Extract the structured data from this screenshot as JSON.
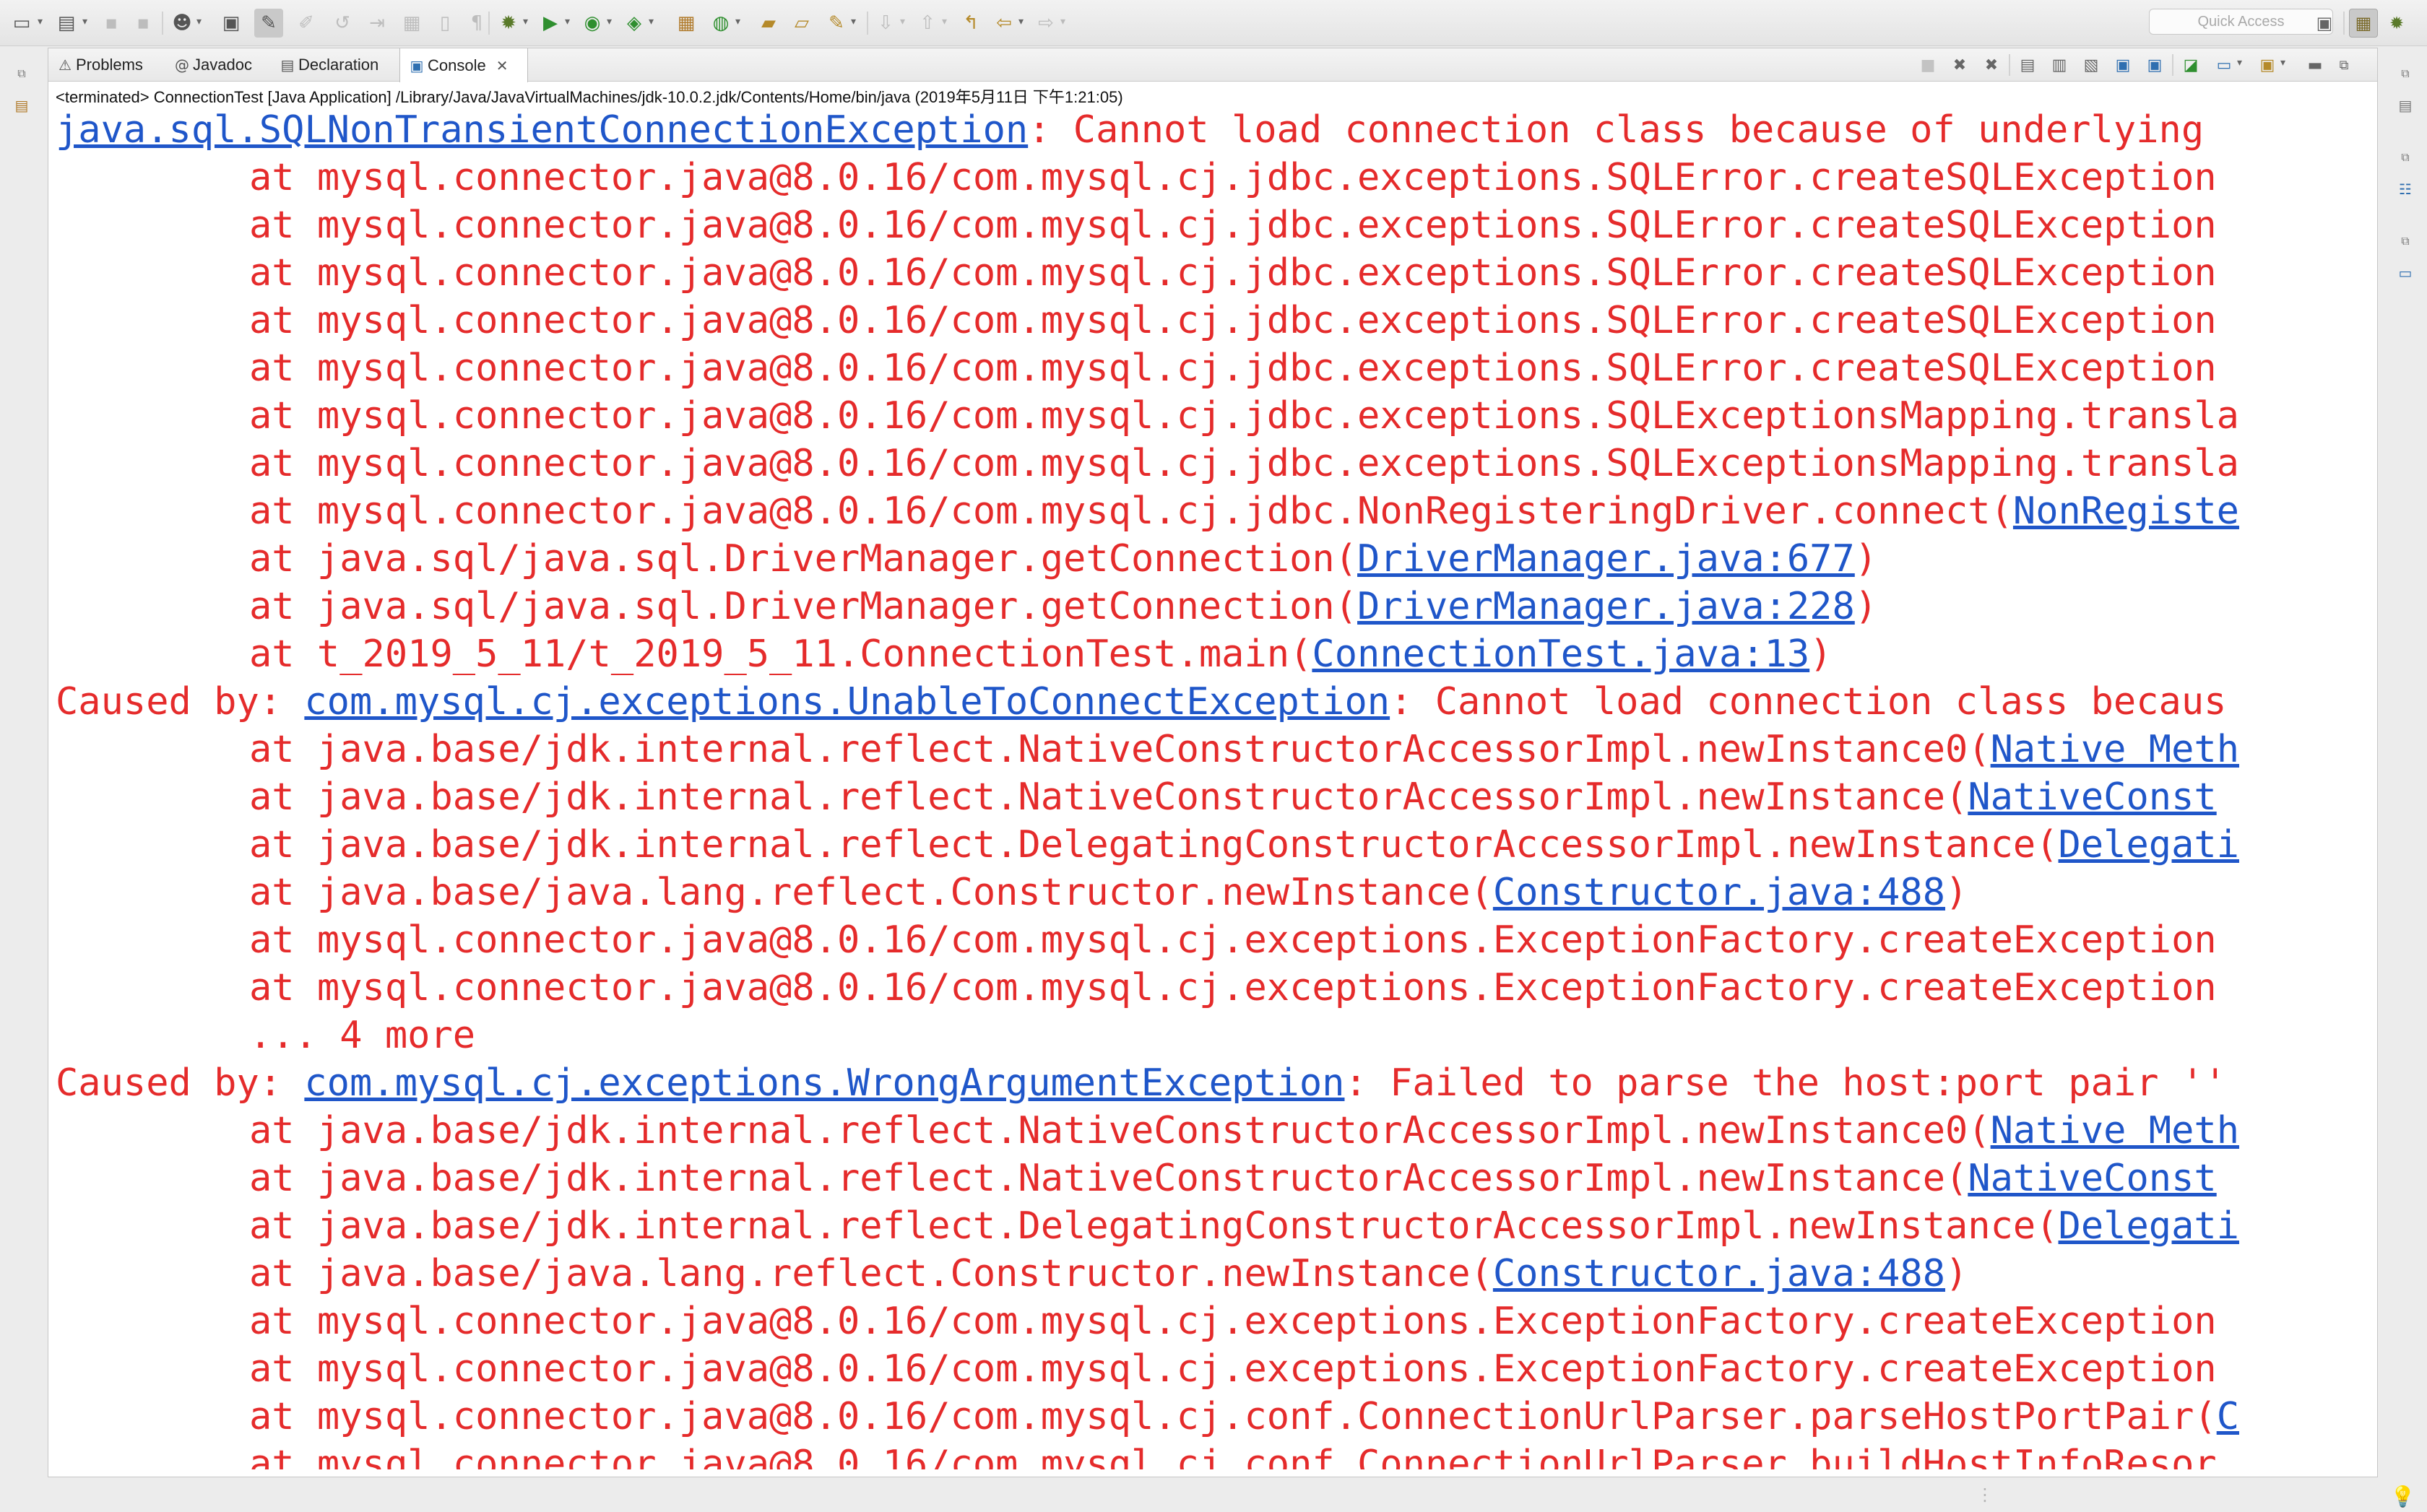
{
  "toolbar": {
    "quick_access_placeholder": "Quick Access"
  },
  "tabs": [
    {
      "icon": "⚠",
      "label": "Problems"
    },
    {
      "icon": "@",
      "label": "Javadoc"
    },
    {
      "icon": "▤",
      "label": "Declaration"
    },
    {
      "icon": "▣",
      "label": "Console",
      "close": "✕"
    }
  ],
  "console": {
    "status": "<terminated> ConnectionTest [Java Application] /Library/Java/JavaVirtualMachines/jdk-10.0.2.jdk/Contents/Home/bin/java (2019年5月11日 下午1:21:05)",
    "lines": [
      {
        "link": "java.sql.SQLNonTransientConnectionException",
        "after": ": Cannot load connection class because of underlying"
      },
      {
        "indent": true,
        "text": "at mysql.connector.java@8.0.16/com.mysql.cj.jdbc.exceptions.SQLError.createSQLException"
      },
      {
        "indent": true,
        "text": "at mysql.connector.java@8.0.16/com.mysql.cj.jdbc.exceptions.SQLError.createSQLException"
      },
      {
        "indent": true,
        "text": "at mysql.connector.java@8.0.16/com.mysql.cj.jdbc.exceptions.SQLError.createSQLException"
      },
      {
        "indent": true,
        "text": "at mysql.connector.java@8.0.16/com.mysql.cj.jdbc.exceptions.SQLError.createSQLException"
      },
      {
        "indent": true,
        "text": "at mysql.connector.java@8.0.16/com.mysql.cj.jdbc.exceptions.SQLError.createSQLException"
      },
      {
        "indent": true,
        "text": "at mysql.connector.java@8.0.16/com.mysql.cj.jdbc.exceptions.SQLExceptionsMapping.transla"
      },
      {
        "indent": true,
        "text": "at mysql.connector.java@8.0.16/com.mysql.cj.jdbc.exceptions.SQLExceptionsMapping.transla"
      },
      {
        "indent": true,
        "text": "at mysql.connector.java@8.0.16/com.mysql.cj.jdbc.NonRegisteringDriver.connect(",
        "link": "NonRegiste"
      },
      {
        "indent": true,
        "text": "at java.sql/java.sql.DriverManager.getConnection(",
        "link": "DriverManager.java:677",
        "after": ")"
      },
      {
        "indent": true,
        "text": "at java.sql/java.sql.DriverManager.getConnection(",
        "link": "DriverManager.java:228",
        "after": ")"
      },
      {
        "indent": true,
        "text": "at t_2019_5_11/t_2019_5_11.ConnectionTest.main(",
        "link": "ConnectionTest.java:13",
        "after": ")"
      },
      {
        "text": "Caused by: ",
        "link": "com.mysql.cj.exceptions.UnableToConnectException",
        "after": ": Cannot load connection class becaus"
      },
      {
        "indent": true,
        "text": "at java.base/jdk.internal.reflect.NativeConstructorAccessorImpl.newInstance0(",
        "link": "Native Meth"
      },
      {
        "indent": true,
        "text": "at java.base/jdk.internal.reflect.NativeConstructorAccessorImpl.newInstance(",
        "link": "NativeConst"
      },
      {
        "indent": true,
        "text": "at java.base/jdk.internal.reflect.DelegatingConstructorAccessorImpl.newInstance(",
        "link": "Delegati"
      },
      {
        "indent": true,
        "text": "at java.base/java.lang.reflect.Constructor.newInstance(",
        "link": "Constructor.java:488",
        "after": ")"
      },
      {
        "indent": true,
        "text": "at mysql.connector.java@8.0.16/com.mysql.cj.exceptions.ExceptionFactory.createException"
      },
      {
        "indent": true,
        "text": "at mysql.connector.java@8.0.16/com.mysql.cj.exceptions.ExceptionFactory.createException"
      },
      {
        "indent": true,
        "text": "... 4 more"
      },
      {
        "text": "Caused by: ",
        "link": "com.mysql.cj.exceptions.WrongArgumentException",
        "after": ": Failed to parse the host:port pair ''"
      },
      {
        "indent": true,
        "text": "at java.base/jdk.internal.reflect.NativeConstructorAccessorImpl.newInstance0(",
        "link": "Native Meth"
      },
      {
        "indent": true,
        "text": "at java.base/jdk.internal.reflect.NativeConstructorAccessorImpl.newInstance(",
        "link": "NativeConst"
      },
      {
        "indent": true,
        "text": "at java.base/jdk.internal.reflect.DelegatingConstructorAccessorImpl.newInstance(",
        "link": "Delegati"
      },
      {
        "indent": true,
        "text": "at java.base/java.lang.reflect.Constructor.newInstance(",
        "link": "Constructor.java:488",
        "after": ")"
      },
      {
        "indent": true,
        "text": "at mysql.connector.java@8.0.16/com.mysql.cj.exceptions.ExceptionFactory.createException"
      },
      {
        "indent": true,
        "text": "at mysql.connector.java@8.0.16/com.mysql.cj.exceptions.ExceptionFactory.createException"
      },
      {
        "indent": true,
        "text": "at mysql.connector.java@8.0.16/com.mysql.cj.conf.ConnectionUrlParser.parseHostPortPair(",
        "link": "C"
      },
      {
        "indent": true,
        "text": "at mysql.connector.java@8.0.16/com.mysql.cj.conf.ConnectionUrlParser.buildHostInfoResor"
      }
    ]
  },
  "colors": {
    "error_text": "#e52b2b",
    "link_text": "#1f56c9"
  }
}
